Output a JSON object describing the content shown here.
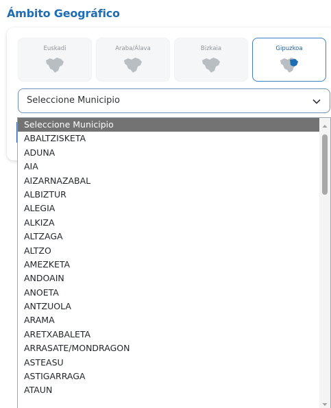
{
  "section": {
    "title": "Ámbito Geográfico"
  },
  "territories": [
    {
      "label": "Euskadi",
      "active": false,
      "icon": "euskadi-map-icon"
    },
    {
      "label": "Araba/Álava",
      "active": false,
      "icon": "araba-map-icon"
    },
    {
      "label": "Bizkaia",
      "active": false,
      "icon": "bizkaia-map-icon"
    },
    {
      "label": "Gipuzkoa",
      "active": true,
      "icon": "gipuzkoa-map-icon"
    }
  ],
  "municipio_select": {
    "value": "Seleccione Municipio",
    "icon": "chevron-down-icon"
  },
  "dropdown": {
    "options": [
      "Seleccione Municipio",
      "ABALTZISKETA",
      "ADUNA",
      "AIA",
      "AIZARNAZABAL",
      "ALBIZTUR",
      "ALEGIA",
      "ALKIZA",
      "ALTZAGA",
      "ALTZO",
      "AMEZKETA",
      "ANDOAIN",
      "ANOETA",
      "ANTZUOLA",
      "ARAMA",
      "ARETXABALETA",
      "ARRASATE/MONDRAGON",
      "ASTEASU",
      "ASTIGARRAGA",
      "ATAUN"
    ],
    "selected_index": 0
  },
  "colors": {
    "title": "#1f6eb4",
    "active_border": "#3b7fc4",
    "active_map": "#1f6eb4",
    "inactive_map": "#b9bec3",
    "highlight": "#737373"
  }
}
